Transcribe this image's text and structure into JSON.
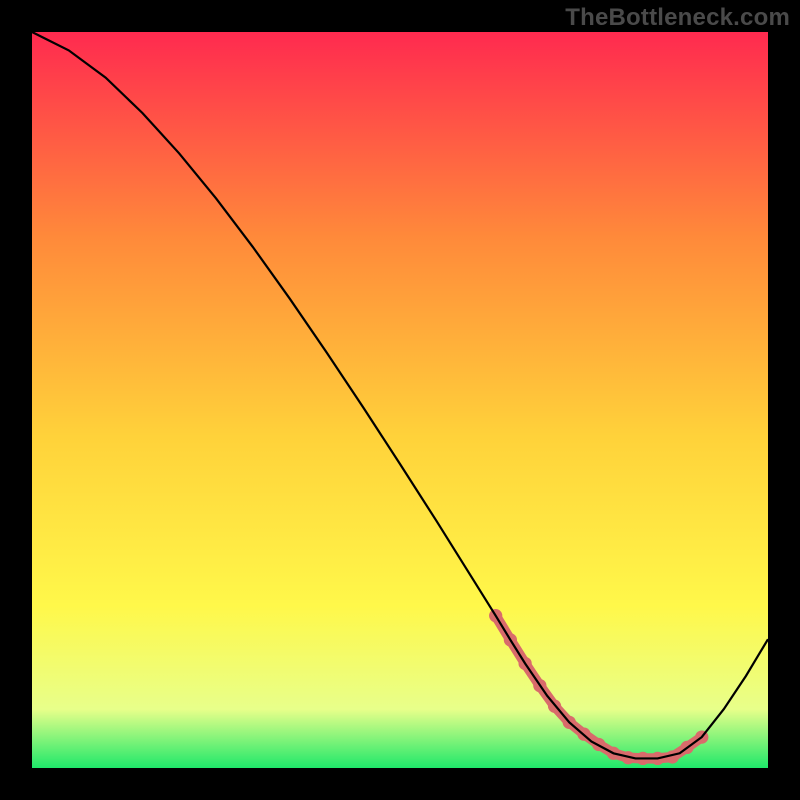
{
  "watermark": "TheBottleneck.com",
  "chart_data": {
    "type": "line",
    "title": "",
    "xlabel": "",
    "ylabel": "",
    "xlim": [
      0,
      100
    ],
    "ylim": [
      0,
      100
    ],
    "series": [
      {
        "name": "curve",
        "x": [
          0,
          2,
          5,
          10,
          15,
          20,
          25,
          30,
          35,
          40,
          45,
          50,
          55,
          60,
          63,
          65,
          67,
          70,
          73,
          76,
          79,
          82,
          85,
          88,
          91,
          94,
          97,
          100
        ],
        "y": [
          100,
          99,
          97.5,
          93.8,
          89.0,
          83.5,
          77.4,
          70.8,
          63.8,
          56.5,
          49.0,
          41.3,
          33.5,
          25.5,
          20.7,
          17.4,
          14.2,
          9.8,
          6.2,
          3.6,
          2.0,
          1.3,
          1.3,
          2.0,
          4.2,
          8.0,
          12.5,
          17.5
        ]
      },
      {
        "name": "highlight-dots",
        "x": [
          63,
          65,
          67,
          69,
          71,
          73,
          75,
          77,
          79,
          81,
          83,
          85,
          87,
          89,
          91
        ],
        "y": [
          20.7,
          17.4,
          14.2,
          11.2,
          8.4,
          6.2,
          4.6,
          3.2,
          2.0,
          1.4,
          1.3,
          1.3,
          1.5,
          2.8,
          4.2
        ]
      }
    ],
    "background_gradient": {
      "top": "#ff2a4f",
      "upper_mid": "#ff8a3a",
      "mid": "#ffd23a",
      "lower_mid": "#fff84a",
      "band": "#e8ff8a",
      "bottom": "#1fe86a"
    },
    "colors": {
      "curve": "#000000",
      "highlight": "#d96b6b",
      "frame": "#000000"
    }
  }
}
